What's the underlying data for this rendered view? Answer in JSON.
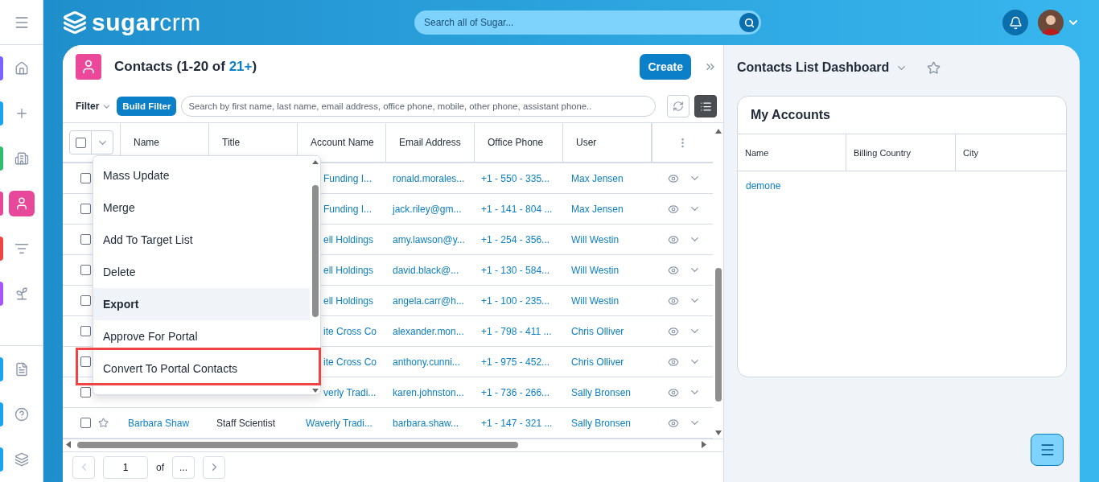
{
  "sidebar": {
    "items": [
      {
        "kind": "home",
        "color": "#7b61ff",
        "selected": false
      },
      {
        "kind": "add",
        "color": "#1aa3f0",
        "selected": false
      },
      {
        "kind": "building",
        "color": "#2ebd6b",
        "selected": false
      },
      {
        "kind": "contact",
        "color": "#e8489a",
        "selected": true
      },
      {
        "kind": "filter",
        "color": "#ef4444",
        "selected": false
      },
      {
        "kind": "plant",
        "color": "#a855f7",
        "selected": false
      }
    ],
    "bottom_items": [
      {
        "kind": "document",
        "color": "#1aa3f0",
        "selected": false
      },
      {
        "kind": "help",
        "color": "#1aa3f0",
        "selected": false
      },
      {
        "kind": "layers",
        "color": "#1aa3f0",
        "selected": false
      }
    ]
  },
  "topbar": {
    "logo": "**sugar**crm",
    "search_placeholder": "Search all of Sugar..."
  },
  "list": {
    "title": "Contacts (1-20 of ",
    "count": "21+",
    "title_end": ")",
    "create_button": "Create",
    "filter_label": "Filter",
    "build_filter": "Build Filter",
    "search_placeholder": "Search by first name, last name, email address, office phone, mobile, other phone, assistant phone..",
    "select_all": {
      "checked": false
    },
    "columns": [
      "Name",
      "Title",
      "Account Name",
      "Email Address",
      "Office Phone",
      "User"
    ],
    "rows": [
      {
        "checked": false,
        "account": "Funding I...",
        "email": "ronald.morales...",
        "phone": "+1 - 550 - 335...",
        "user": "Max Jensen"
      },
      {
        "checked": false,
        "account": "Funding I...",
        "email": "jack.riley@gm...",
        "phone": "+1 - 141 - 804 ...",
        "user": "Max Jensen"
      },
      {
        "checked": false,
        "account": "ell Holdings",
        "email": "amy.lawson@y...",
        "phone": "+1 - 254 - 356...",
        "user": "Will Westin"
      },
      {
        "checked": false,
        "account": "ell Holdings",
        "email": "david.black@...",
        "phone": "+1 - 130 - 584...",
        "user": "Will Westin"
      },
      {
        "checked": false,
        "account": "ell Holdings",
        "email": "angela.carr@h...",
        "phone": "+1 - 100 - 235...",
        "user": "Will Westin"
      },
      {
        "checked": false,
        "account": "ite Cross Co",
        "email": "alexander.mon...",
        "phone": "+1 - 798 - 411 ...",
        "user": "Chris Olliver"
      },
      {
        "checked": false,
        "account": "ite Cross Co",
        "email": "anthony.cunni...",
        "phone": "+1 - 975 - 452...",
        "user": "Chris Olliver"
      },
      {
        "checked": false,
        "account": "verly Tradi...",
        "email": "karen.johnston...",
        "phone": "+1 - 736 - 266...",
        "user": "Sally Bronsen"
      },
      {
        "checked": false,
        "name": "Barbara Shaw",
        "title": "Staff Scientist",
        "account": "Waverly Tradi...",
        "email": "barbara.shaw...",
        "phone": "+1 - 147 - 321 ...",
        "user": "Sally Bronsen"
      }
    ],
    "menu": [
      {
        "label": "Mass Update",
        "hovered": false,
        "highlighted": false
      },
      {
        "label": "Merge",
        "hovered": false,
        "highlighted": false
      },
      {
        "label": "Add To Target List",
        "hovered": false,
        "highlighted": false
      },
      {
        "label": "Delete",
        "hovered": false,
        "highlighted": false
      },
      {
        "label": "Export",
        "hovered": true,
        "highlighted": false
      },
      {
        "label": "Approve For Portal",
        "hovered": false,
        "highlighted": false
      },
      {
        "label": "Convert To Portal Contacts",
        "hovered": false,
        "highlighted": true
      }
    ],
    "pagination": {
      "page": "1",
      "of": "of",
      "more": "..."
    }
  },
  "dashboard": {
    "title": "Contacts List Dashboard",
    "card_title": "My Accounts",
    "columns": [
      "Name",
      "Billing Country",
      "City"
    ],
    "rows": [
      {
        "name": "demone"
      }
    ]
  }
}
